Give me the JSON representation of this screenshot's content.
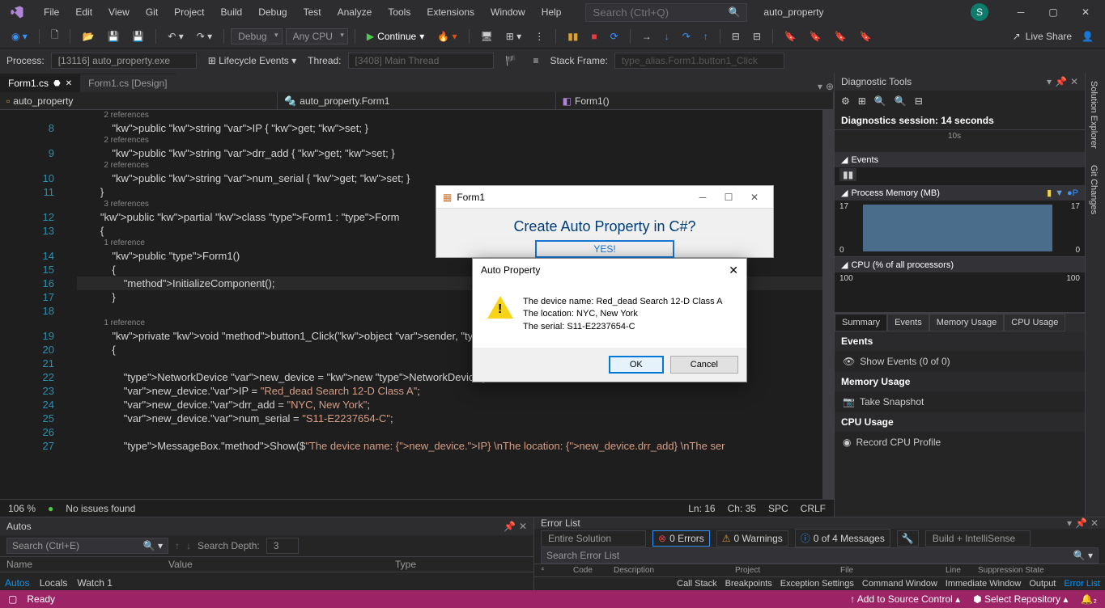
{
  "menu": [
    "File",
    "Edit",
    "View",
    "Git",
    "Project",
    "Build",
    "Debug",
    "Test",
    "Analyze",
    "Tools",
    "Extensions",
    "Window",
    "Help"
  ],
  "search_placeholder": "Search (Ctrl+Q)",
  "solution_name": "auto_property",
  "user_initial": "S",
  "toolbar": {
    "config": "Debug",
    "platform": "Any CPU",
    "continue": "Continue",
    "live_share": "Live Share"
  },
  "debugbar": {
    "process_label": "Process:",
    "process": "[13116] auto_property.exe",
    "lifecycle": "Lifecycle Events",
    "thread_label": "Thread:",
    "thread": "[3408] Main Thread",
    "frame_label": "Stack Frame:",
    "frame": "type_alias.Form1.button1_Click"
  },
  "tabs": {
    "active": "Form1.cs",
    "inactive": "Form1.cs [Design]"
  },
  "navbar": {
    "project": "auto_property",
    "class": "auto_property.Form1",
    "member": "Form1()"
  },
  "code": {
    "lines": [
      {
        "n": "8",
        "ref": "2 references",
        "t": "            public string IP { get; set; }"
      },
      {
        "n": "9",
        "ref": "2 references",
        "t": "            public string drr_add { get; set; }"
      },
      {
        "n": "10",
        "ref": "2 references",
        "t": "            public string num_serial { get; set; }"
      },
      {
        "n": "11",
        "t": "        }"
      },
      {
        "n": "12",
        "ref": "3 references",
        "t": "        public partial class Form1 : Form"
      },
      {
        "n": "13",
        "t": "        {"
      },
      {
        "n": "14",
        "ref": "1 reference",
        "t": "            public Form1()"
      },
      {
        "n": "15",
        "t": "            {"
      },
      {
        "n": "16",
        "t": "                InitializeComponent();",
        "current": true
      },
      {
        "n": "17",
        "t": "            }"
      },
      {
        "n": "18",
        "t": ""
      },
      {
        "n": "19",
        "ref": "1 reference",
        "t": "            private void button1_Click(object sender, EventArgs e)"
      },
      {
        "n": "20",
        "t": "            {"
      },
      {
        "n": "21",
        "t": ""
      },
      {
        "n": "22",
        "t": "                NetworkDevice new_device = new NetworkDevice();"
      },
      {
        "n": "23",
        "t": "                new_device.IP = \"Red_dead Search 12-D Class A\";"
      },
      {
        "n": "24",
        "t": "                new_device.drr_add = \"NYC, New York\";"
      },
      {
        "n": "25",
        "t": "                new_device.num_serial = \"S11-E2237654-C\";"
      },
      {
        "n": "26",
        "t": ""
      },
      {
        "n": "27",
        "t": "                MessageBox.Show($\"The device name: {new_device.IP} \\nThe location: {new_device.drr_add} \\nThe ser"
      }
    ]
  },
  "editor_status": {
    "zoom": "106 %",
    "issues": "No issues found",
    "ln": "Ln: 16",
    "ch": "Ch: 35",
    "ins": "SPC",
    "eol": "CRLF"
  },
  "form1": {
    "title": "Form1",
    "heading": "Create Auto Property in C#?",
    "button": "YES!"
  },
  "msgbox": {
    "title": "Auto Property",
    "line1": "The device name: Red_dead Search 12-D Class A",
    "line2": "The location: NYC, New York",
    "line3": "The serial: S11-E2237654-C",
    "ok": "OK",
    "cancel": "Cancel"
  },
  "diag": {
    "title": "Diagnostic Tools",
    "session": "Diagnostics session: 14 seconds",
    "time_tick": "10s",
    "events_h": "Events",
    "mem_h": "Process Memory (MB)",
    "mem_max": "17",
    "mem_min": "0",
    "cpu_h": "CPU (% of all processors)",
    "cpu_max": "100",
    "cpu_min": "100",
    "tabs": [
      "Summary",
      "Events",
      "Memory Usage",
      "CPU Usage"
    ],
    "events_group": "Events",
    "show_events": "Show Events (0 of 0)",
    "mem_group": "Memory Usage",
    "snapshot": "Take Snapshot",
    "cpu_group": "CPU Usage",
    "record": "Record CPU Profile"
  },
  "vtabs": [
    "Solution Explorer",
    "Git Changes"
  ],
  "autos": {
    "title": "Autos",
    "search": "Search (Ctrl+E)",
    "depth_label": "Search Depth:",
    "depth": "3",
    "cols": [
      "Name",
      "Value",
      "Type"
    ],
    "tabs": [
      "Autos",
      "Locals",
      "Watch 1"
    ]
  },
  "errors": {
    "title": "Error List",
    "scope": "Entire Solution",
    "e": "0 Errors",
    "w": "0 Warnings",
    "m": "0 of 4 Messages",
    "filter": "Build + IntelliSense",
    "search": "Search Error List",
    "cols": [
      "",
      "Code",
      "Description",
      "Project",
      "File",
      "Line",
      "Suppression State"
    ],
    "tabs": [
      "Call Stack",
      "Breakpoints",
      "Exception Settings",
      "Command Window",
      "Immediate Window",
      "Output",
      "Error List"
    ]
  },
  "statusbar": {
    "ready": "Ready",
    "source": "Add to Source Control",
    "repo": "Select Repository"
  }
}
